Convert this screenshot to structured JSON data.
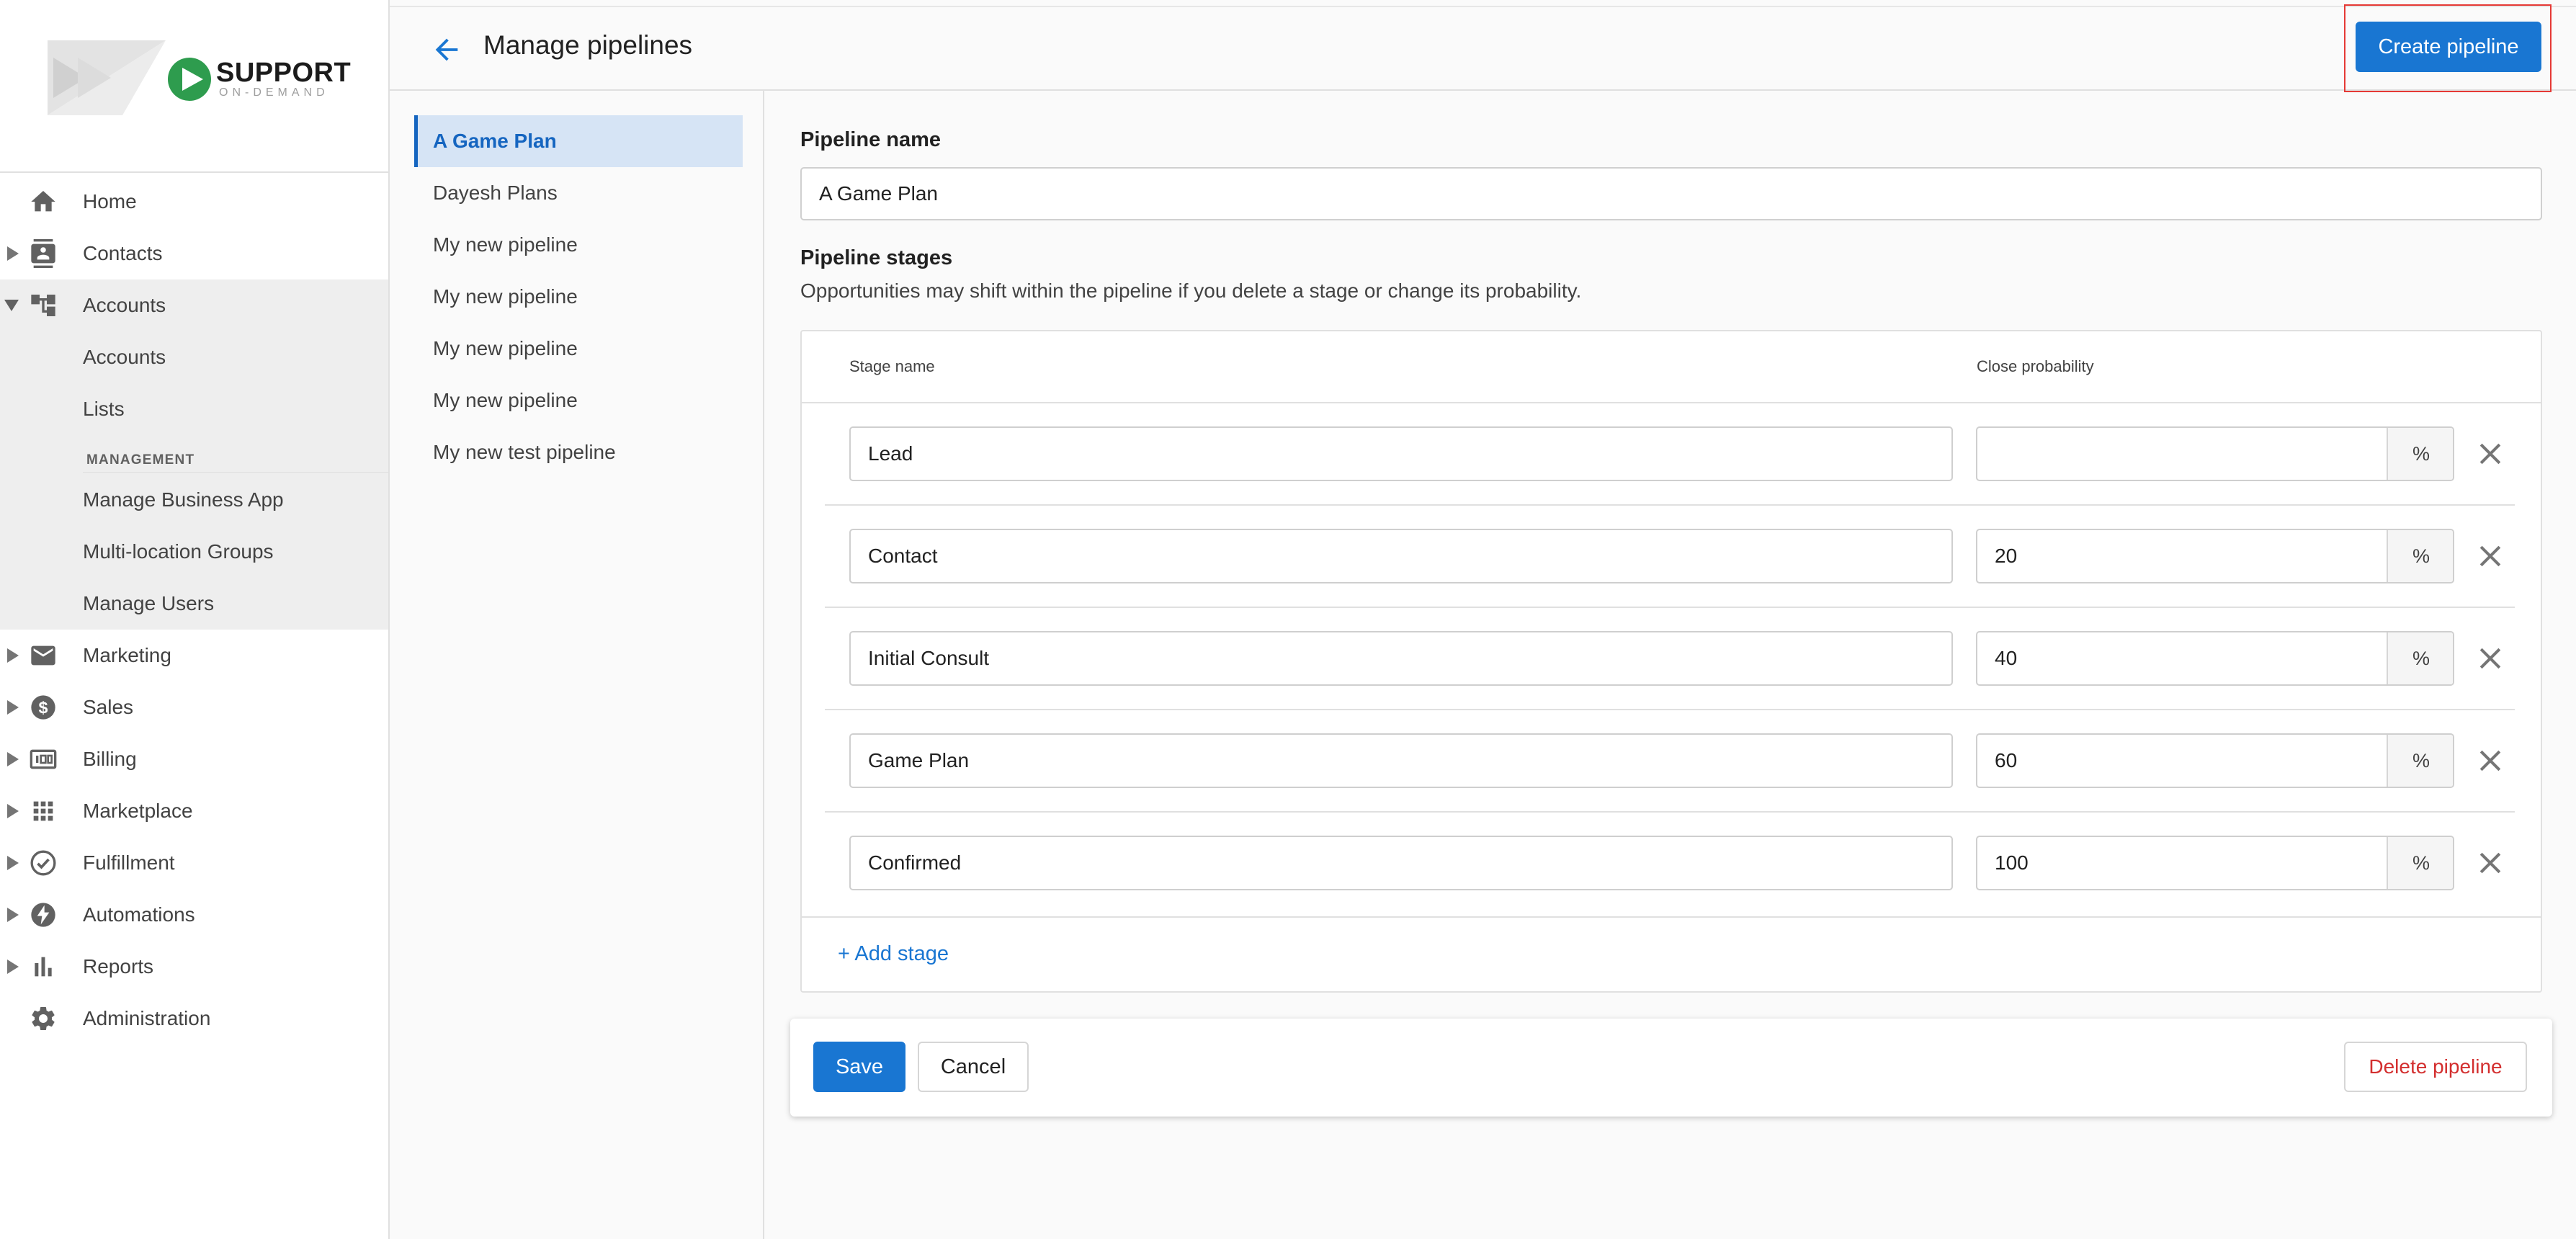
{
  "brand": {
    "name": "SUPPORT",
    "tagline": "ON-DEMAND",
    "accent": "#2e9c4e"
  },
  "colors": {
    "primary": "#1976d2",
    "danger": "#d32f2f",
    "highlight": "#e53935"
  },
  "nav": {
    "items": [
      {
        "label": "Home",
        "icon": "home-icon"
      },
      {
        "label": "Contacts",
        "icon": "contacts-icon"
      },
      {
        "label": "Accounts",
        "icon": "accounts-icon"
      },
      {
        "label": "Marketing",
        "icon": "mail-icon"
      },
      {
        "label": "Sales",
        "icon": "dollar-icon"
      },
      {
        "label": "Billing",
        "icon": "billing-icon"
      },
      {
        "label": "Marketplace",
        "icon": "grid-icon"
      },
      {
        "label": "Fulfillment",
        "icon": "check-circle-icon"
      },
      {
        "label": "Automations",
        "icon": "bolt-icon"
      },
      {
        "label": "Reports",
        "icon": "bar-chart-icon"
      },
      {
        "label": "Administration",
        "icon": "gear-icon"
      }
    ],
    "accounts_sub": [
      "Accounts",
      "Lists"
    ],
    "management_heading": "MANAGEMENT",
    "management_items": [
      "Manage Business App",
      "Multi-location Groups",
      "Manage Users"
    ]
  },
  "header": {
    "title": "Manage pipelines",
    "create_label": "Create pipeline"
  },
  "pipelines": [
    "A Game Plan",
    "Dayesh Plans",
    "My new pipeline",
    "My new pipeline",
    "My new pipeline",
    "My new pipeline",
    "My new test pipeline"
  ],
  "form": {
    "name_label": "Pipeline name",
    "name_value": "A Game Plan",
    "stages_label": "Pipeline stages",
    "stages_desc": "Opportunities may shift within the pipeline if you delete a stage or change its probability.",
    "col_stage": "Stage name",
    "col_prob": "Close probability",
    "percent": "%",
    "stages": [
      {
        "name": "Lead",
        "prob": ""
      },
      {
        "name": "Contact",
        "prob": "20"
      },
      {
        "name": "Initial Consult",
        "prob": "40"
      },
      {
        "name": "Game Plan",
        "prob": "60"
      },
      {
        "name": "Confirmed",
        "prob": "100"
      }
    ],
    "add_stage": "+ Add stage"
  },
  "actions": {
    "save": "Save",
    "cancel": "Cancel",
    "delete": "Delete pipeline"
  }
}
